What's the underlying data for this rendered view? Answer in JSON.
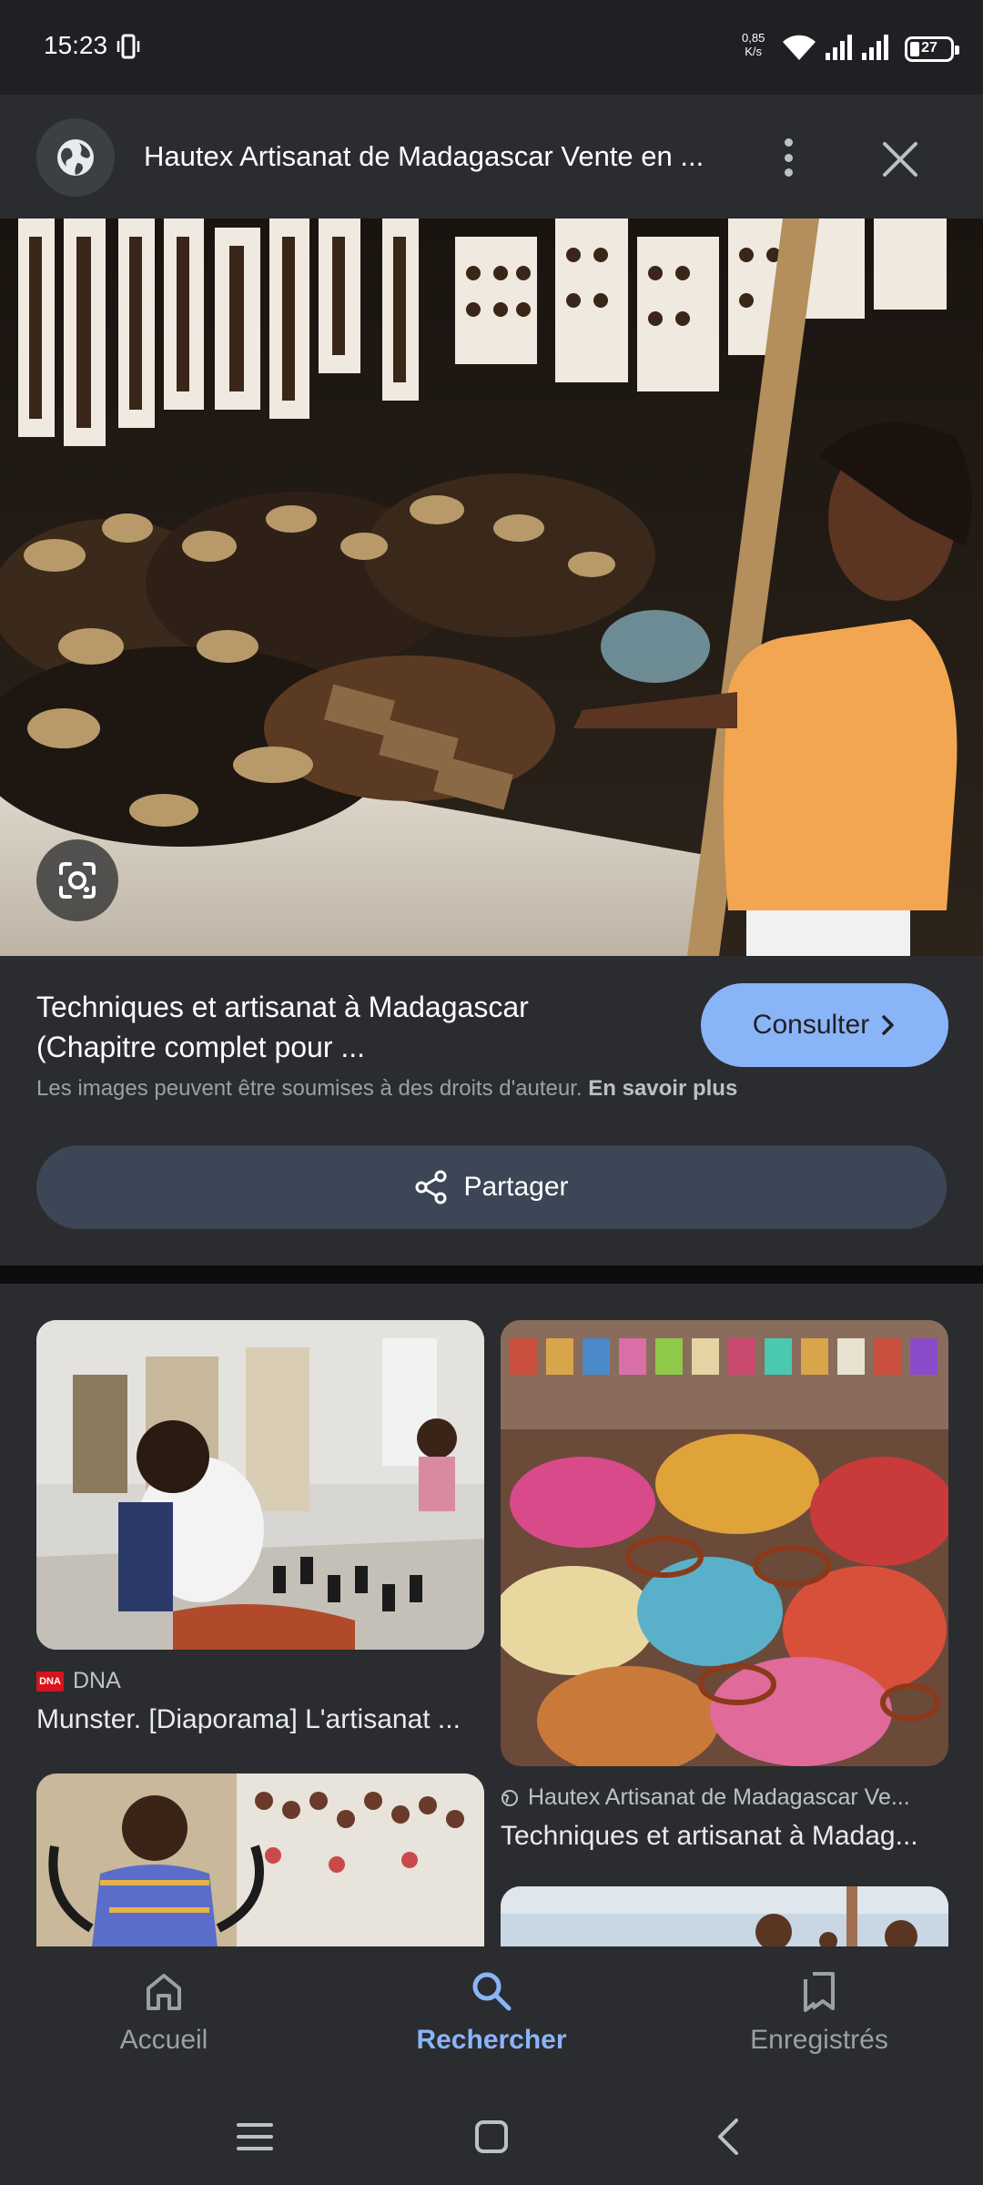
{
  "status_bar": {
    "time": "15:23",
    "speed_value": "0,85",
    "speed_unit": "K/s",
    "battery": "27"
  },
  "header": {
    "title": "Hautex Artisanat de Madagascar Vente en ..."
  },
  "result": {
    "title_line1": "Techniques et artisanat à Madagascar",
    "title_line2": "(Chapitre complet pour ...",
    "consult_label": "Consulter",
    "copyright_text": "Les images peuvent être soumises à des droits d'auteur.",
    "learn_more": "En savoir plus",
    "share_label": "Partager"
  },
  "related": [
    {
      "source": "DNA",
      "source_logo": "DNA",
      "title": "Munster. [Diaporama] L'artisanat ..."
    },
    {
      "source": "Hautex Artisanat de Madagascar Ve...",
      "title": "Techniques et artisanat à Madag..."
    }
  ],
  "bottom_nav": {
    "items": [
      {
        "label": "Accueil",
        "icon": "home-icon"
      },
      {
        "label": "Rechercher",
        "icon": "search-icon",
        "active": true
      },
      {
        "label": "Enregistrés",
        "icon": "bookmarks-icon"
      }
    ]
  },
  "colors": {
    "accent": "#8ab4f8",
    "background": "#1f2023",
    "surface": "#2b2c30",
    "share_button": "#3c4656"
  }
}
